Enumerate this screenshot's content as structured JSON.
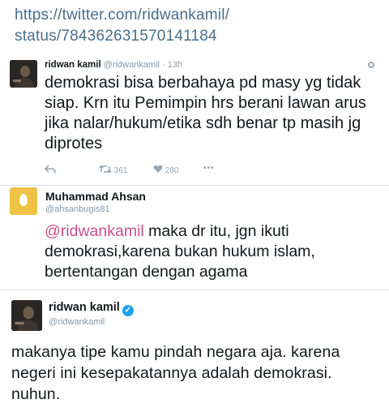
{
  "url": {
    "line1": "https://twitter.com/ridwankamil/",
    "line2": "status/784362631570141184"
  },
  "tweet1": {
    "name": "ridwan kamil",
    "handle": "@ridwankamil",
    "time": "· 13h",
    "text": "demokrasi bisa berbahaya pd masy yg tidak siap. Krn itu Pemimpin hrs berani lawan arus jika nalar/hukum/etika sdh benar tp masih jg diprotes",
    "retweets": "361",
    "likes": "280",
    "more": "•••"
  },
  "tweet2": {
    "name": "Muhammad Ahsan",
    "handle": "@ahsanbugis81",
    "mention": "@ridwankamil",
    "text": " maka dr itu, jgn ikuti demokrasi,karena bukan hukum islam, bertentangan dengan agama"
  },
  "tweet3": {
    "name": "ridwan kamil",
    "handle": "@ridwankamil",
    "verified_mark": "✓",
    "text": "makanya tipe kamu pindah negara aja. karena negeri ini kesepakatannya adalah demokrasi. nuhun."
  },
  "icons": {
    "reply": "reply-icon",
    "retweet": "retweet-icon",
    "like": "heart-icon",
    "more": "more-icon",
    "settings": "gear-icon",
    "verified": "verified-badge-icon"
  },
  "colors": {
    "link": "#4a6e8a",
    "mention": "#c94f8a",
    "verified": "#1da1f2",
    "egg_avatar": "#f0c246",
    "muted": "#8899a6"
  }
}
